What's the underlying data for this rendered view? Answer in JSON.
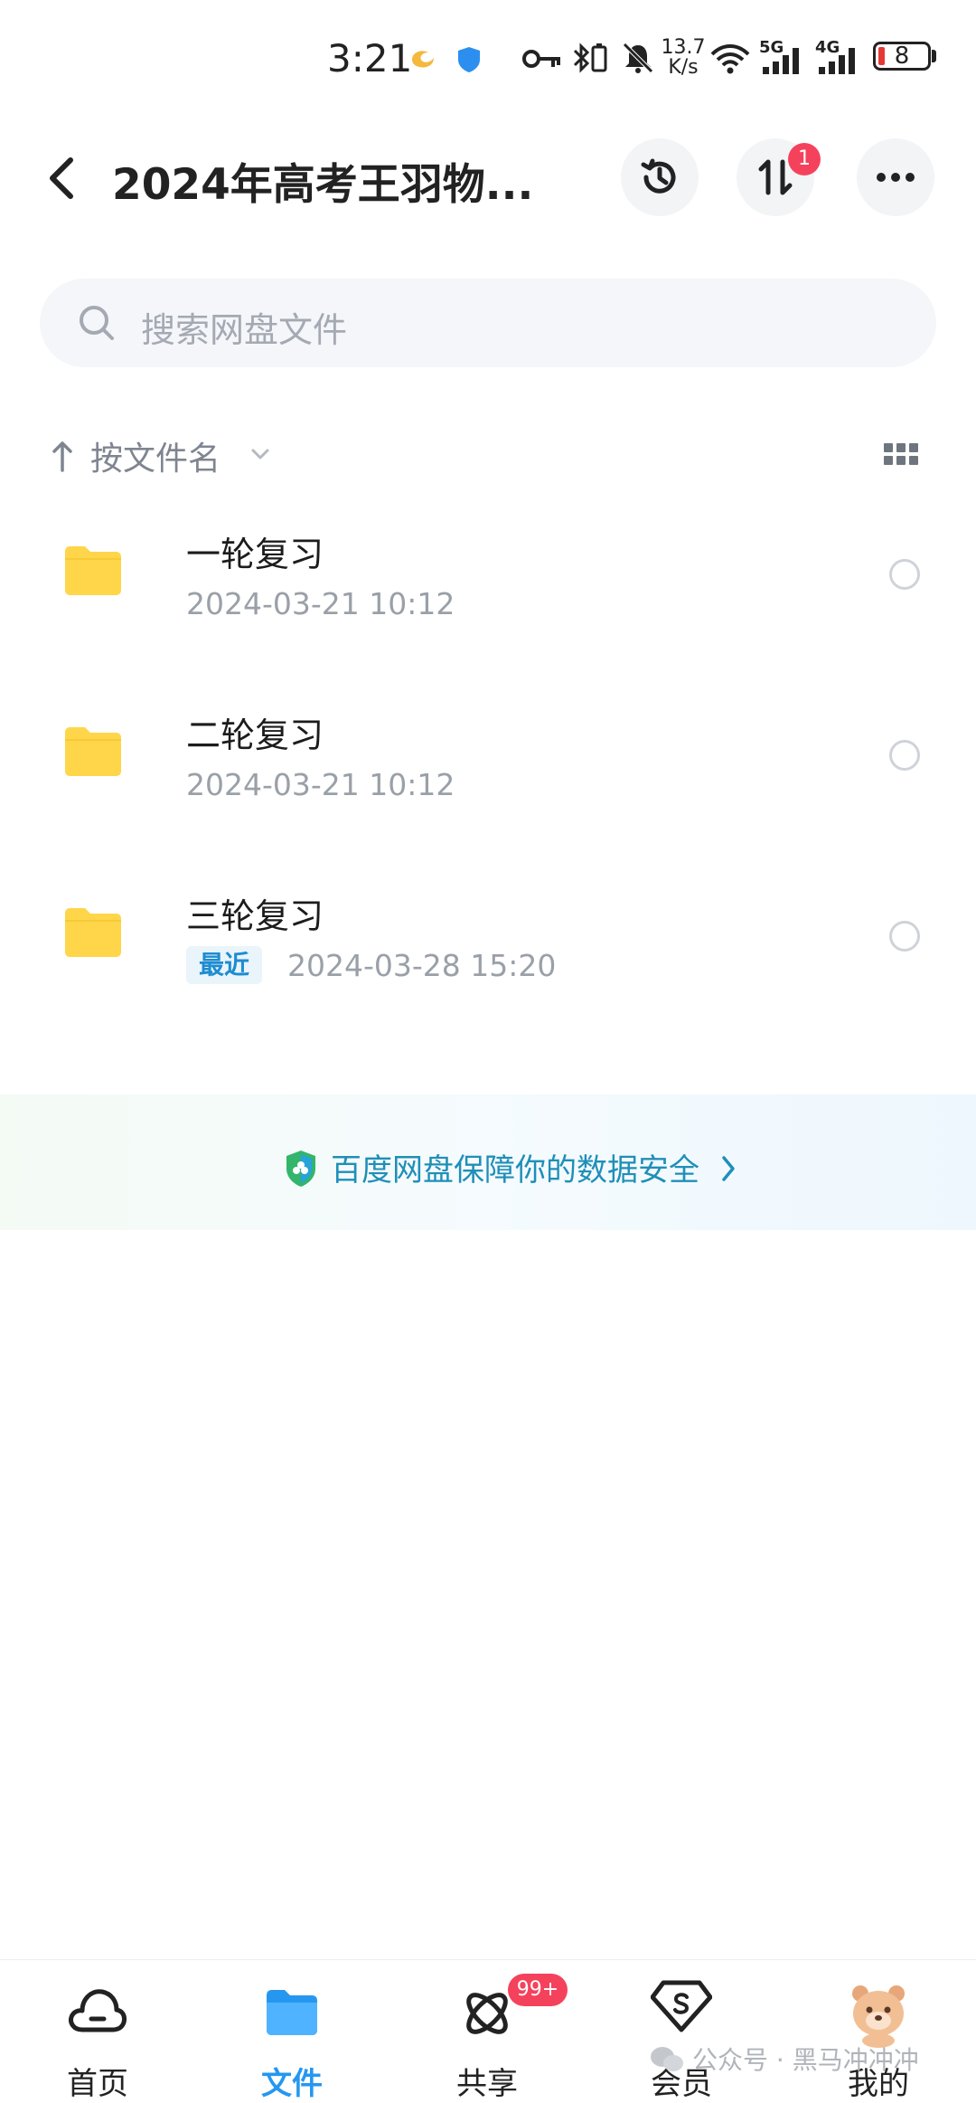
{
  "status_bar": {
    "time": "3:21",
    "net_speed_value": "13.7",
    "net_speed_unit": "K/s",
    "battery_level": "8",
    "signal_5g": "5G",
    "signal_4g": "4G"
  },
  "header": {
    "title": "2024年高考王羽物...",
    "transfer_badge": "1"
  },
  "search": {
    "placeholder": "搜索网盘文件"
  },
  "sort": {
    "label": "按文件名"
  },
  "files": [
    {
      "name": "一轮复习",
      "date": "2024-03-21  10:12",
      "tag": ""
    },
    {
      "name": "二轮复习",
      "date": "2024-03-21  10:12",
      "tag": ""
    },
    {
      "name": "三轮复习",
      "date": "2024-03-28  15:20",
      "tag": "最近"
    }
  ],
  "banner": {
    "text": "百度网盘保障你的数据安全"
  },
  "bottom_nav": {
    "items": [
      {
        "label": "首页",
        "active": false
      },
      {
        "label": "文件",
        "active": true
      },
      {
        "label": "共享",
        "active": false,
        "badge": "99+"
      },
      {
        "label": "会员",
        "active": false
      },
      {
        "label": "我的",
        "active": false
      }
    ]
  },
  "watermark": "公众号 · 黑马冲冲冲",
  "colors": {
    "accent": "#2697f0",
    "folder": "#ffd54a",
    "badge": "#f5425c",
    "banner_text": "#1f8fb8"
  }
}
